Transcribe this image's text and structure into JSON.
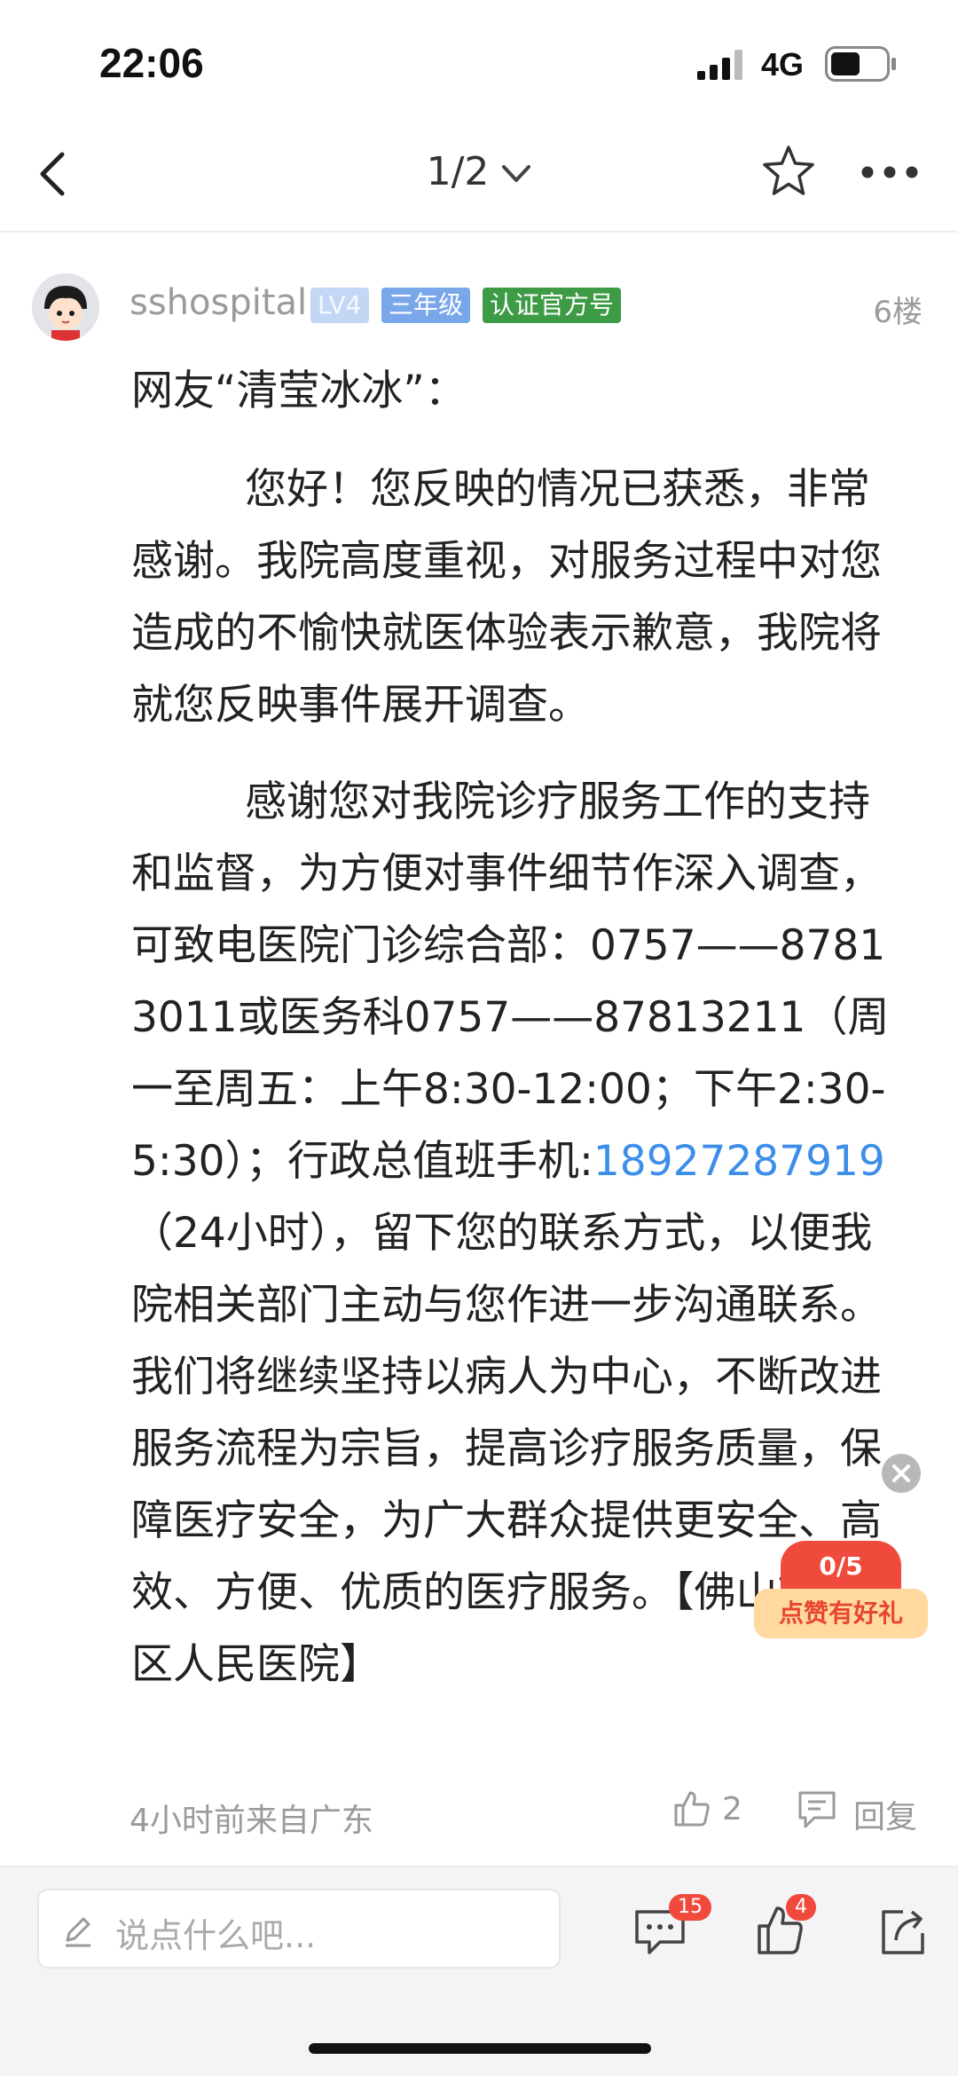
{
  "status_bar": {
    "time": "22:06",
    "network": "4G"
  },
  "nav": {
    "page_indicator": "1/2"
  },
  "post": {
    "username": "sshospital",
    "badges": {
      "level": "LV4",
      "grade": "三年级",
      "official": "认证官方号"
    },
    "floor": "6楼",
    "greeting": "网友“清莹冰冰”：",
    "paragraph1": "您好！您反映的情况已获悉，非常感谢。我院高度重视，对服务过程中对您造成的不愉快就医体验表示歉意，我院将就您反映事件展开调查。",
    "paragraph2_before_phone": "感谢您对我院诊疗服务工作的支持和监督，为方便对事件细节作深入调查，可致电医院门诊综合部：0757——87813011或医务科0757——87813211（周一至周五：上午8:30-12:00；下午2:30-5:30）；行政总值班手机:",
    "phone": "18927287919",
    "paragraph2_after_phone": "（24小时），留下您的联系方式，以便我院相关部门主动与您作进一步沟通联系。我们将继续坚持以病人为中心，不断改进服务流程为宗旨，提高诊疗服务质量，保障医疗安全，为广大群众提供更安全、高效、方便、优质的医疗服务。【佛山市三水区人民医院】",
    "meta": "4小时前来自广东",
    "like_count": "2",
    "reply_label": "回复"
  },
  "gift_popup": {
    "count": "0/5",
    "label": "点赞有好礼"
  },
  "bottom_bar": {
    "input_placeholder": "说点什么吧...",
    "comments_count": "15",
    "likes_count": "4"
  },
  "colors": {
    "link": "#3d8ee8",
    "badge_red": "#f04a3c",
    "official_green": "#3d9b45"
  }
}
